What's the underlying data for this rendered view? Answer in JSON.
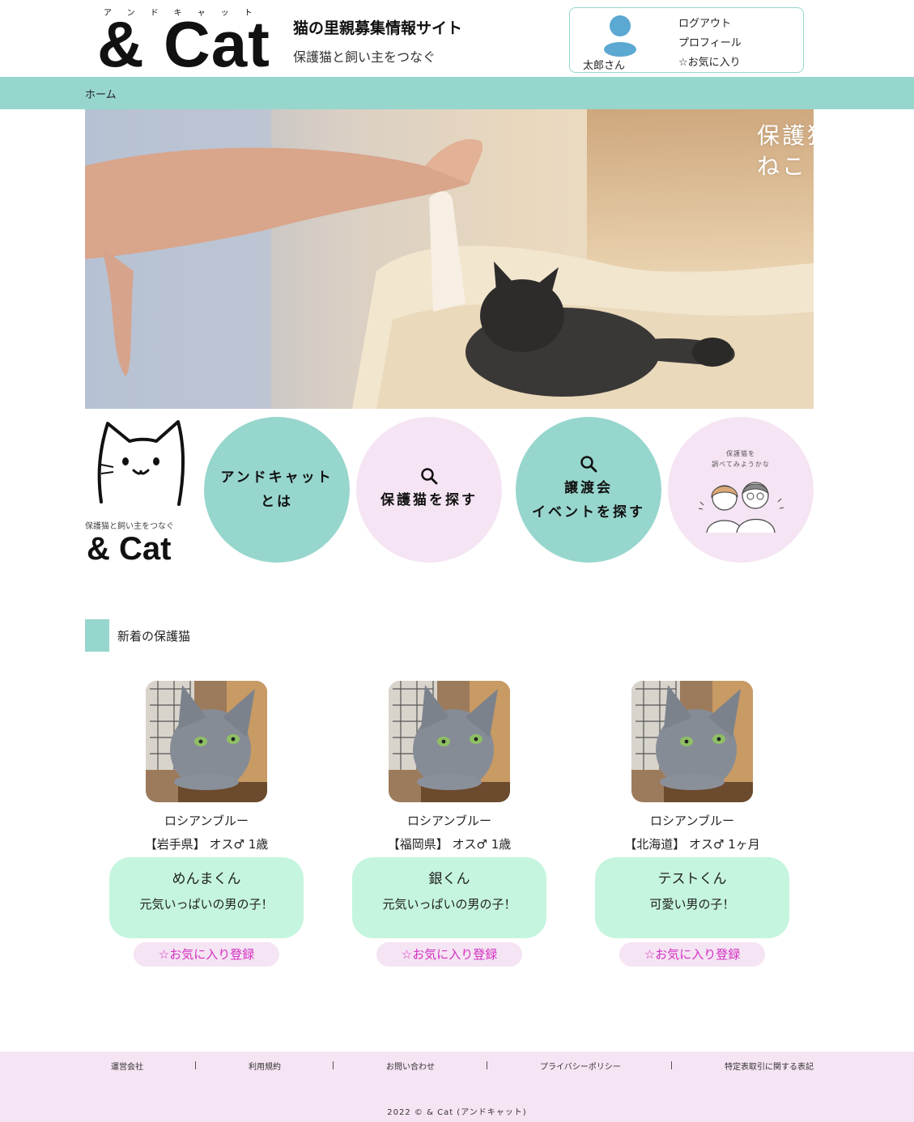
{
  "header": {
    "logo_ruby": "アンドキャット",
    "logo_text": "& Cat",
    "site_title": "猫の里親募集情報サイト",
    "site_subtitle": "保護猫と飼い主をつなぐ",
    "user": {
      "name": "太郎さん",
      "menu": [
        "ログアウト",
        "プロフィール",
        "☆お気に入り"
      ]
    }
  },
  "nav": {
    "home": "ホーム"
  },
  "hero": {
    "caption": "保護猫\nねこ"
  },
  "brand_card": {
    "tagline": "保護猫と飼い主をつなぐ",
    "name": "& Cat"
  },
  "circles": [
    {
      "label": "アンドキャット\nとは",
      "icon": "none",
      "color": "#96d6cd"
    },
    {
      "label": "保護猫を探す",
      "icon": "search-icon",
      "color": "#f5e4f3"
    },
    {
      "label": "譲渡会\nイベントを探す",
      "icon": "search-icon",
      "color": "#96d6cd"
    },
    {
      "illustration_caption": "保護猫を\n調べてみようかな",
      "color": "#f5e4f3"
    }
  ],
  "section": {
    "title": "新着の保護猫"
  },
  "cats": [
    {
      "breed": "ロシアンブルー",
      "info": "【岩手県】 オス♂ 1歳",
      "name": "めんまくん",
      "message": "元気いっぱいの男の子！",
      "fav_label": "☆お気に入り登録"
    },
    {
      "breed": "ロシアンブルー",
      "info": "【福岡県】 オス♂ 1歳",
      "name": "銀くん",
      "message": "元気いっぱいの男の子！",
      "fav_label": "☆お気に入り登録"
    },
    {
      "breed": "ロシアンブルー",
      "info": "【北海道】 オス♂ 1ヶ月",
      "name": "テストくん",
      "message": "可愛い男の子！",
      "fav_label": "☆お気に入り登録"
    }
  ],
  "footer": {
    "links": [
      "運営会社",
      "利用規約",
      "お問い合わせ",
      "プライバシーポリシー",
      "特定表取引に関する表記"
    ],
    "copyright": "2022 © & Cat (アンドキャット)"
  },
  "colors": {
    "mint": "#96d6cd",
    "pink": "#f5e4f3",
    "bubble": "#c5f5de",
    "fav_text": "#d231c2",
    "avatar": "#5ba8d3"
  }
}
